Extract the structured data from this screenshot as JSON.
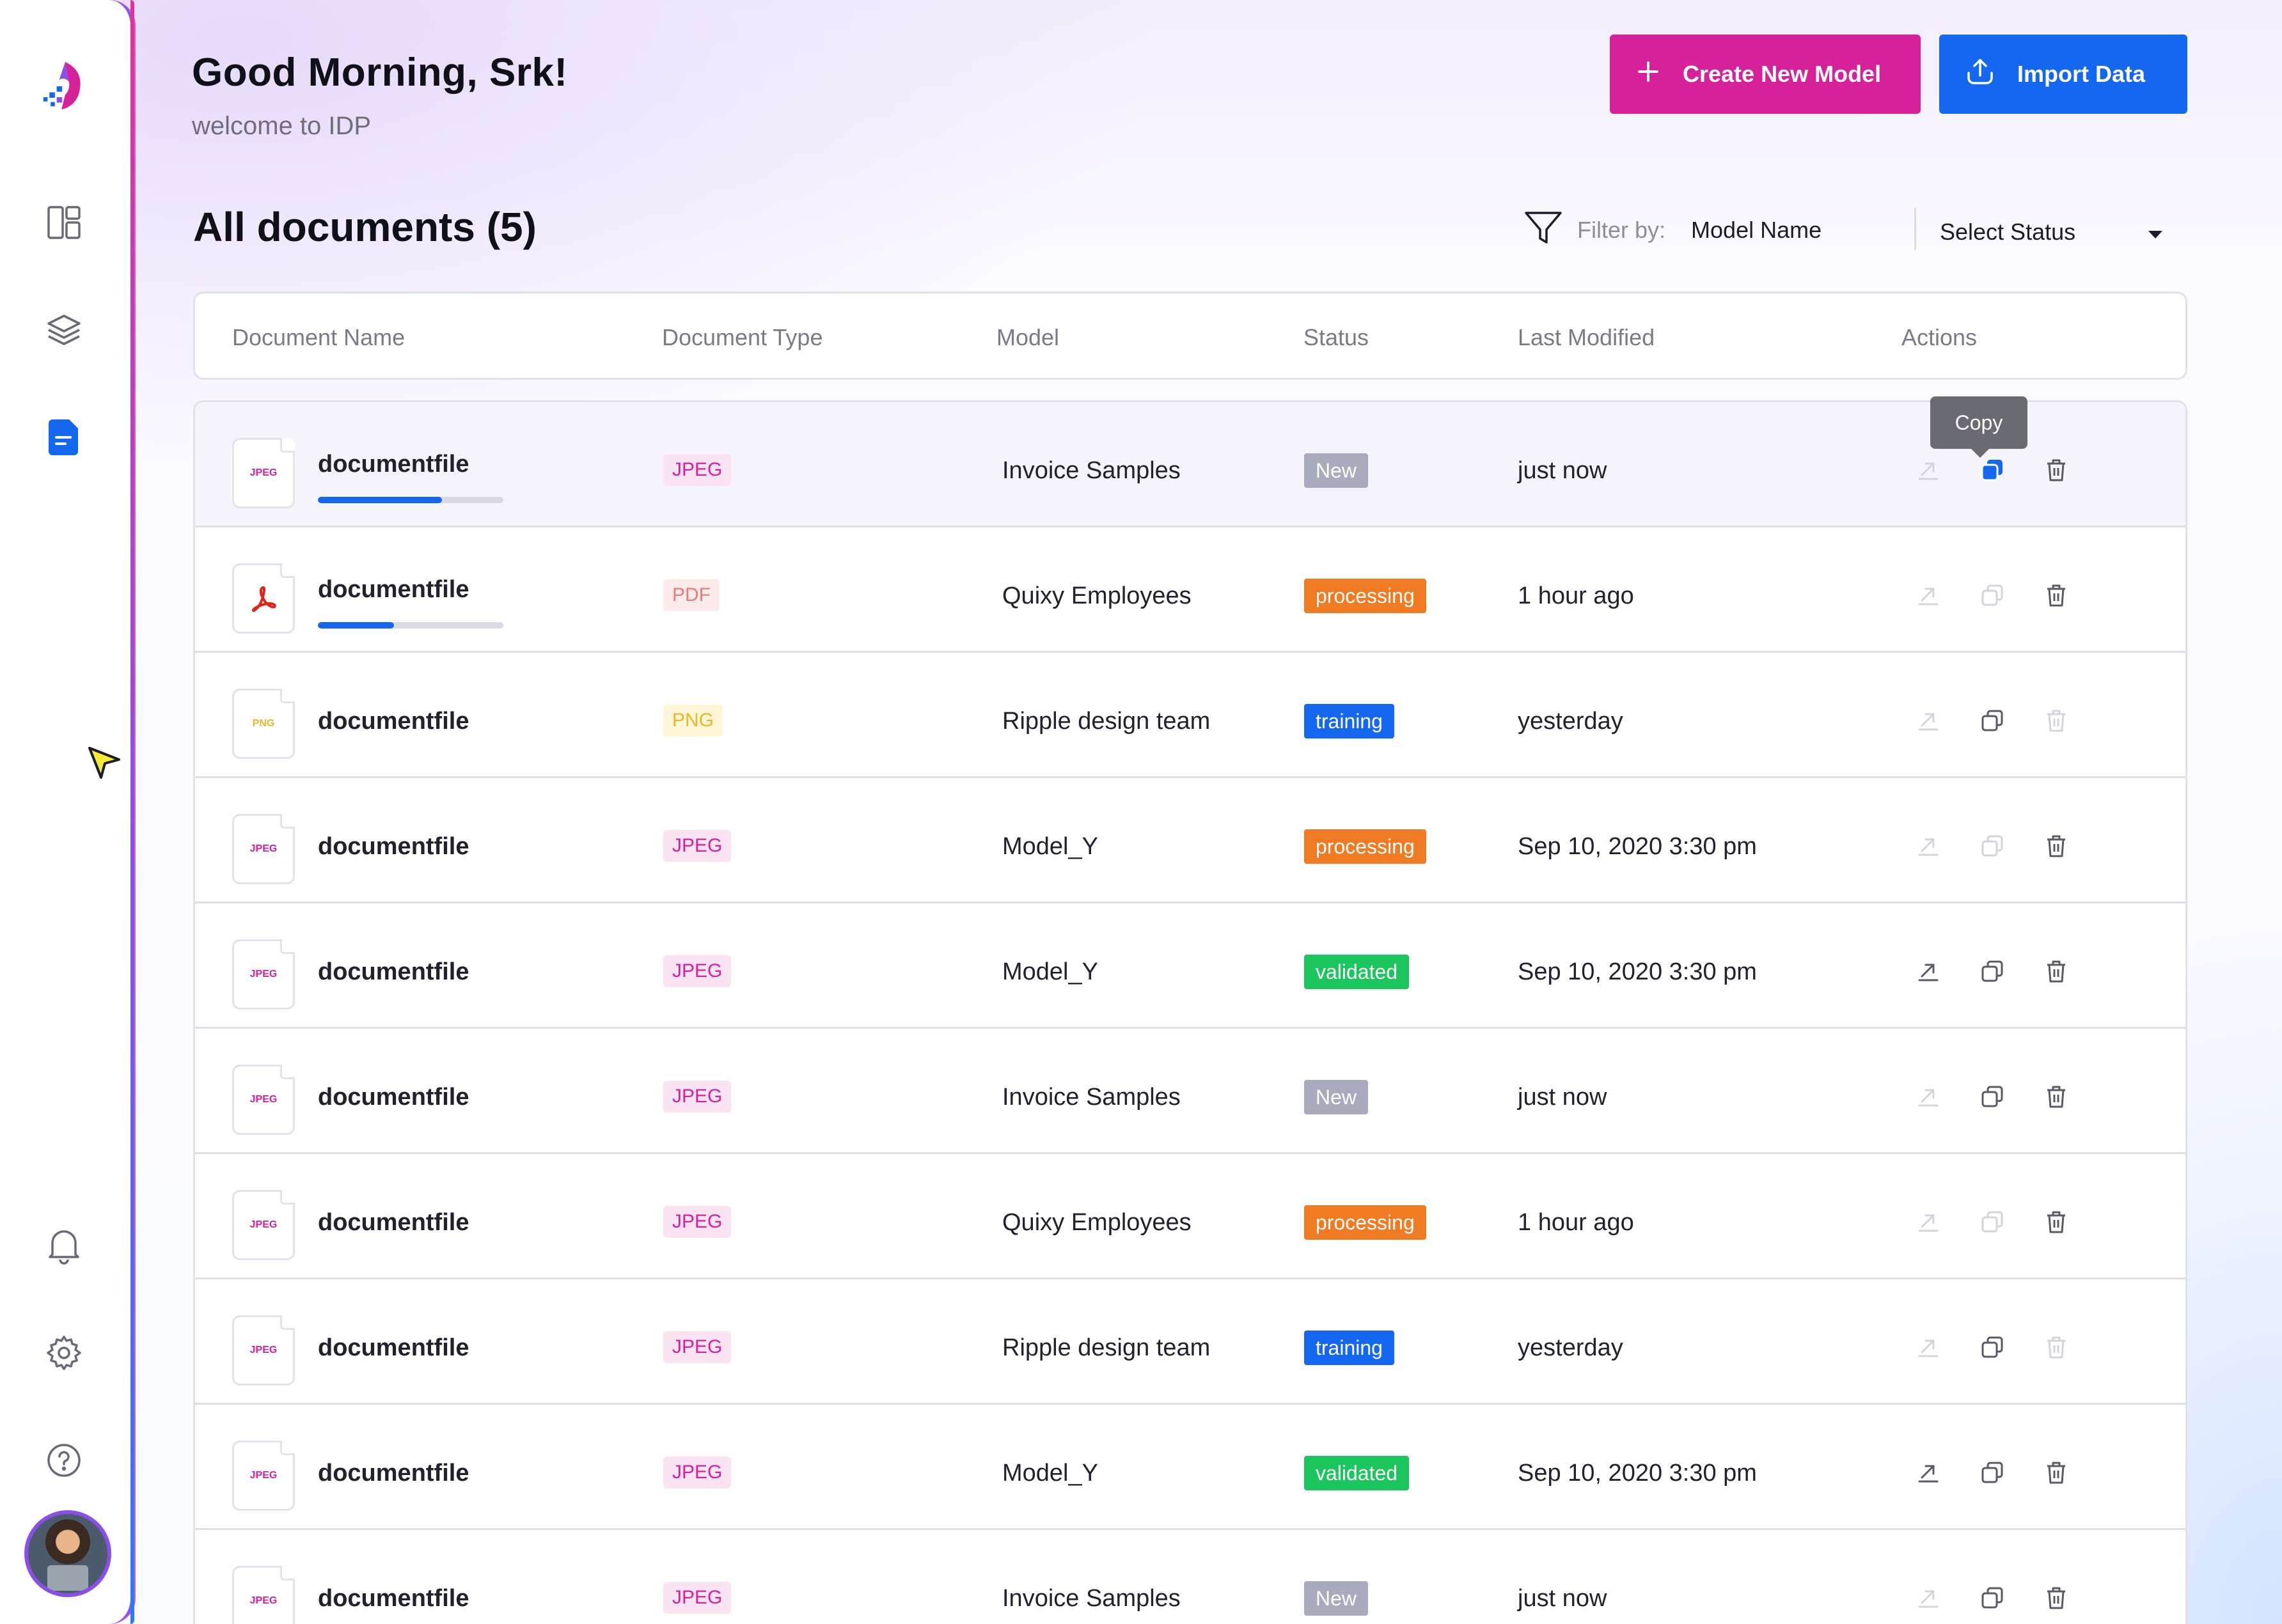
{
  "header": {
    "greeting": "Good Morning, Srk!",
    "welcome": "welcome to IDP",
    "create_button": "Create New Model",
    "import_button": "Import Data"
  },
  "sidebar": {
    "icons": [
      "logo-icon",
      "dashboard-icon",
      "layers-icon",
      "document-icon",
      "bell-icon",
      "gear-icon",
      "help-icon"
    ],
    "active": "document-icon",
    "accent_color": "#1468f0"
  },
  "section": {
    "title": "All documents (5)",
    "filter_label": "Filter by:",
    "filter_value": "Model Name",
    "status_select": "Select Status"
  },
  "table": {
    "columns": [
      "Document Name",
      "Document Type",
      "Model",
      "Status",
      "Last Modified",
      "Actions"
    ],
    "tooltip": "Copy",
    "rows": [
      {
        "name": "documentfile",
        "type": "JPEG",
        "model": "Invoice Samples",
        "status": "New",
        "modified": "just now",
        "progress": 0.67
      },
      {
        "name": "documentfile",
        "type": "PDF",
        "model": "Quixy Employees",
        "status": "processing",
        "modified": "1 hour ago",
        "progress": 0.41
      },
      {
        "name": "documentfile",
        "type": "PNG",
        "model": "Ripple design team",
        "status": "training",
        "modified": "yesterday"
      },
      {
        "name": "documentfile",
        "type": "JPEG",
        "model": "Model_Y",
        "status": "processing",
        "modified": "Sep 10, 2020 3:30 pm"
      },
      {
        "name": "documentfile",
        "type": "JPEG",
        "model": "Model_Y",
        "status": "validated",
        "modified": "Sep 10, 2020 3:30 pm"
      },
      {
        "name": "documentfile",
        "type": "JPEG",
        "model": "Invoice Samples",
        "status": "New",
        "modified": "just now"
      },
      {
        "name": "documentfile",
        "type": "JPEG",
        "model": "Quixy Employees",
        "status": "processing",
        "modified": "1 hour ago"
      },
      {
        "name": "documentfile",
        "type": "JPEG",
        "model": "Ripple design team",
        "status": "training",
        "modified": "yesterday"
      },
      {
        "name": "documentfile",
        "type": "JPEG",
        "model": "Model_Y",
        "status": "validated",
        "modified": "Sep 10, 2020 3:30 pm"
      },
      {
        "name": "documentfile",
        "type": "JPEG",
        "model": "Invoice Samples",
        "status": "New",
        "modified": "just now"
      }
    ]
  },
  "colors": {
    "brand_pink": "#d6219a",
    "brand_blue": "#1468f0",
    "status_new": "#a9aabd",
    "status_processing": "#f07b22",
    "status_training": "#1468f0",
    "status_validated": "#1bc75c"
  }
}
